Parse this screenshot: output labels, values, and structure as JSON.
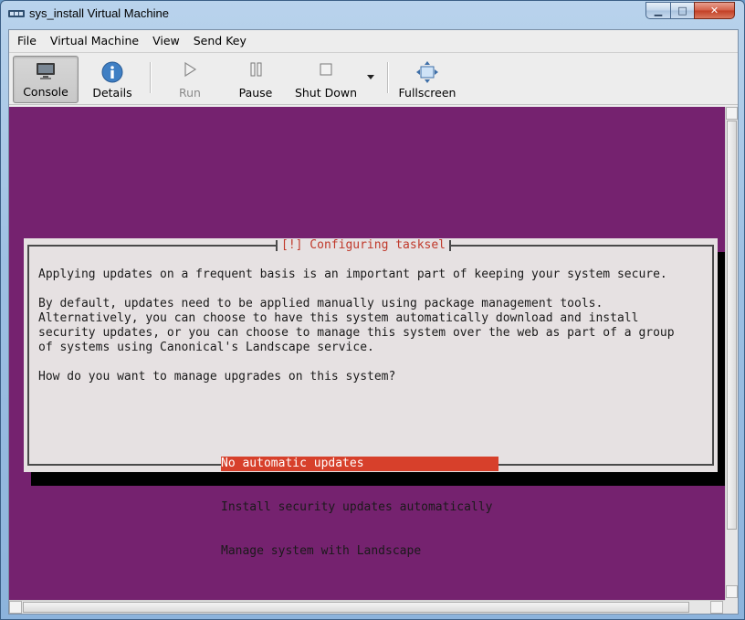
{
  "window": {
    "title": "sys_install Virtual Machine",
    "controls": {
      "minimize": "▁",
      "maximize": "□",
      "close": "✕"
    }
  },
  "menubar": [
    "File",
    "Virtual Machine",
    "View",
    "Send Key"
  ],
  "toolbar": {
    "console": "Console",
    "details": "Details",
    "run": "Run",
    "pause": "Pause",
    "shutdown": "Shut Down",
    "fullscreen": "Fullscreen"
  },
  "console_screen": {
    "background": "#75226f",
    "dialog": {
      "title": "[!] Configuring tasksel",
      "paragraphs": [
        "Applying updates on a frequent basis is an important part of keeping your system secure.",
        "By default, updates need to be applied manually using package management tools.\nAlternatively, you can choose to have this system automatically download and install\nsecurity updates, or you can choose to manage this system over the web as part of a group\nof systems using Canonical's Landscape service.",
        "How do you want to manage upgrades on this system?"
      ],
      "options": [
        {
          "label": "No automatic updates",
          "selected": true
        },
        {
          "label": "Install security updates automatically",
          "selected": false
        },
        {
          "label": "Manage system with Landscape",
          "selected": false
        }
      ]
    }
  }
}
